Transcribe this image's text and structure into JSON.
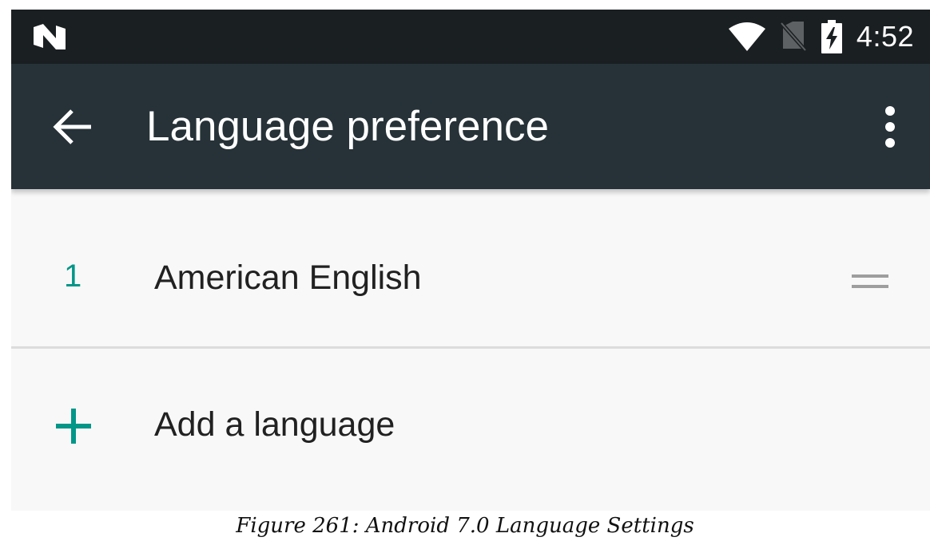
{
  "status_bar": {
    "time": "4:52",
    "icons": [
      "android-n-icon",
      "wifi-icon",
      "no-sim-icon",
      "battery-charging-icon"
    ]
  },
  "app_bar": {
    "title": "Language preference",
    "icons": [
      "back-arrow-icon",
      "overflow-menu-icon"
    ]
  },
  "languages": [
    {
      "index": "1",
      "name": "American English"
    }
  ],
  "add_language": {
    "label": "Add a language",
    "icon": "plus-icon"
  },
  "caption": "Figure 261: Android 7.0 Language Settings",
  "colors": {
    "status_bar": "#1a1f22",
    "app_bar": "#263238",
    "background": "#f8f8f8",
    "accent": "#009688",
    "text_primary": "#212121",
    "divider": "#dcdcdc"
  }
}
